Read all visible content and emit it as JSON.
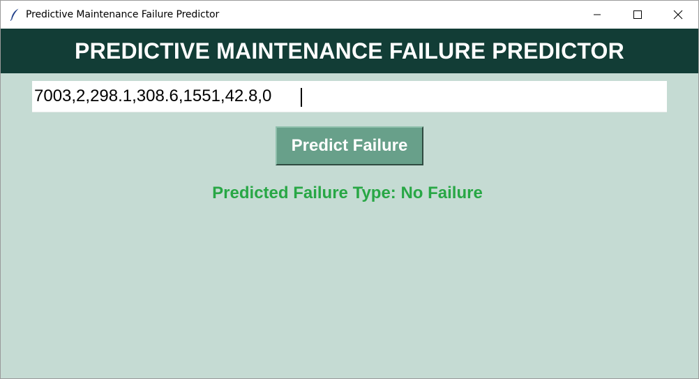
{
  "window": {
    "title": "Predictive Maintenance Failure Predictor",
    "app_icon": "feather-icon",
    "controls": [
      "minimize-icon",
      "maximize-icon",
      "close-icon"
    ]
  },
  "header": {
    "title": "PREDICTIVE MAINTENANCE FAILURE PREDICTOR"
  },
  "input": {
    "value": "7003,2,298.1,308.6,1551,42.8,0"
  },
  "button": {
    "label": "Predict Failure"
  },
  "result": {
    "text": "Predicted Failure Type: No Failure"
  },
  "colors": {
    "background": "#c5dbd3",
    "header_bg": "#123d36",
    "button_bg": "#68a08a",
    "result_text": "#28a745"
  }
}
